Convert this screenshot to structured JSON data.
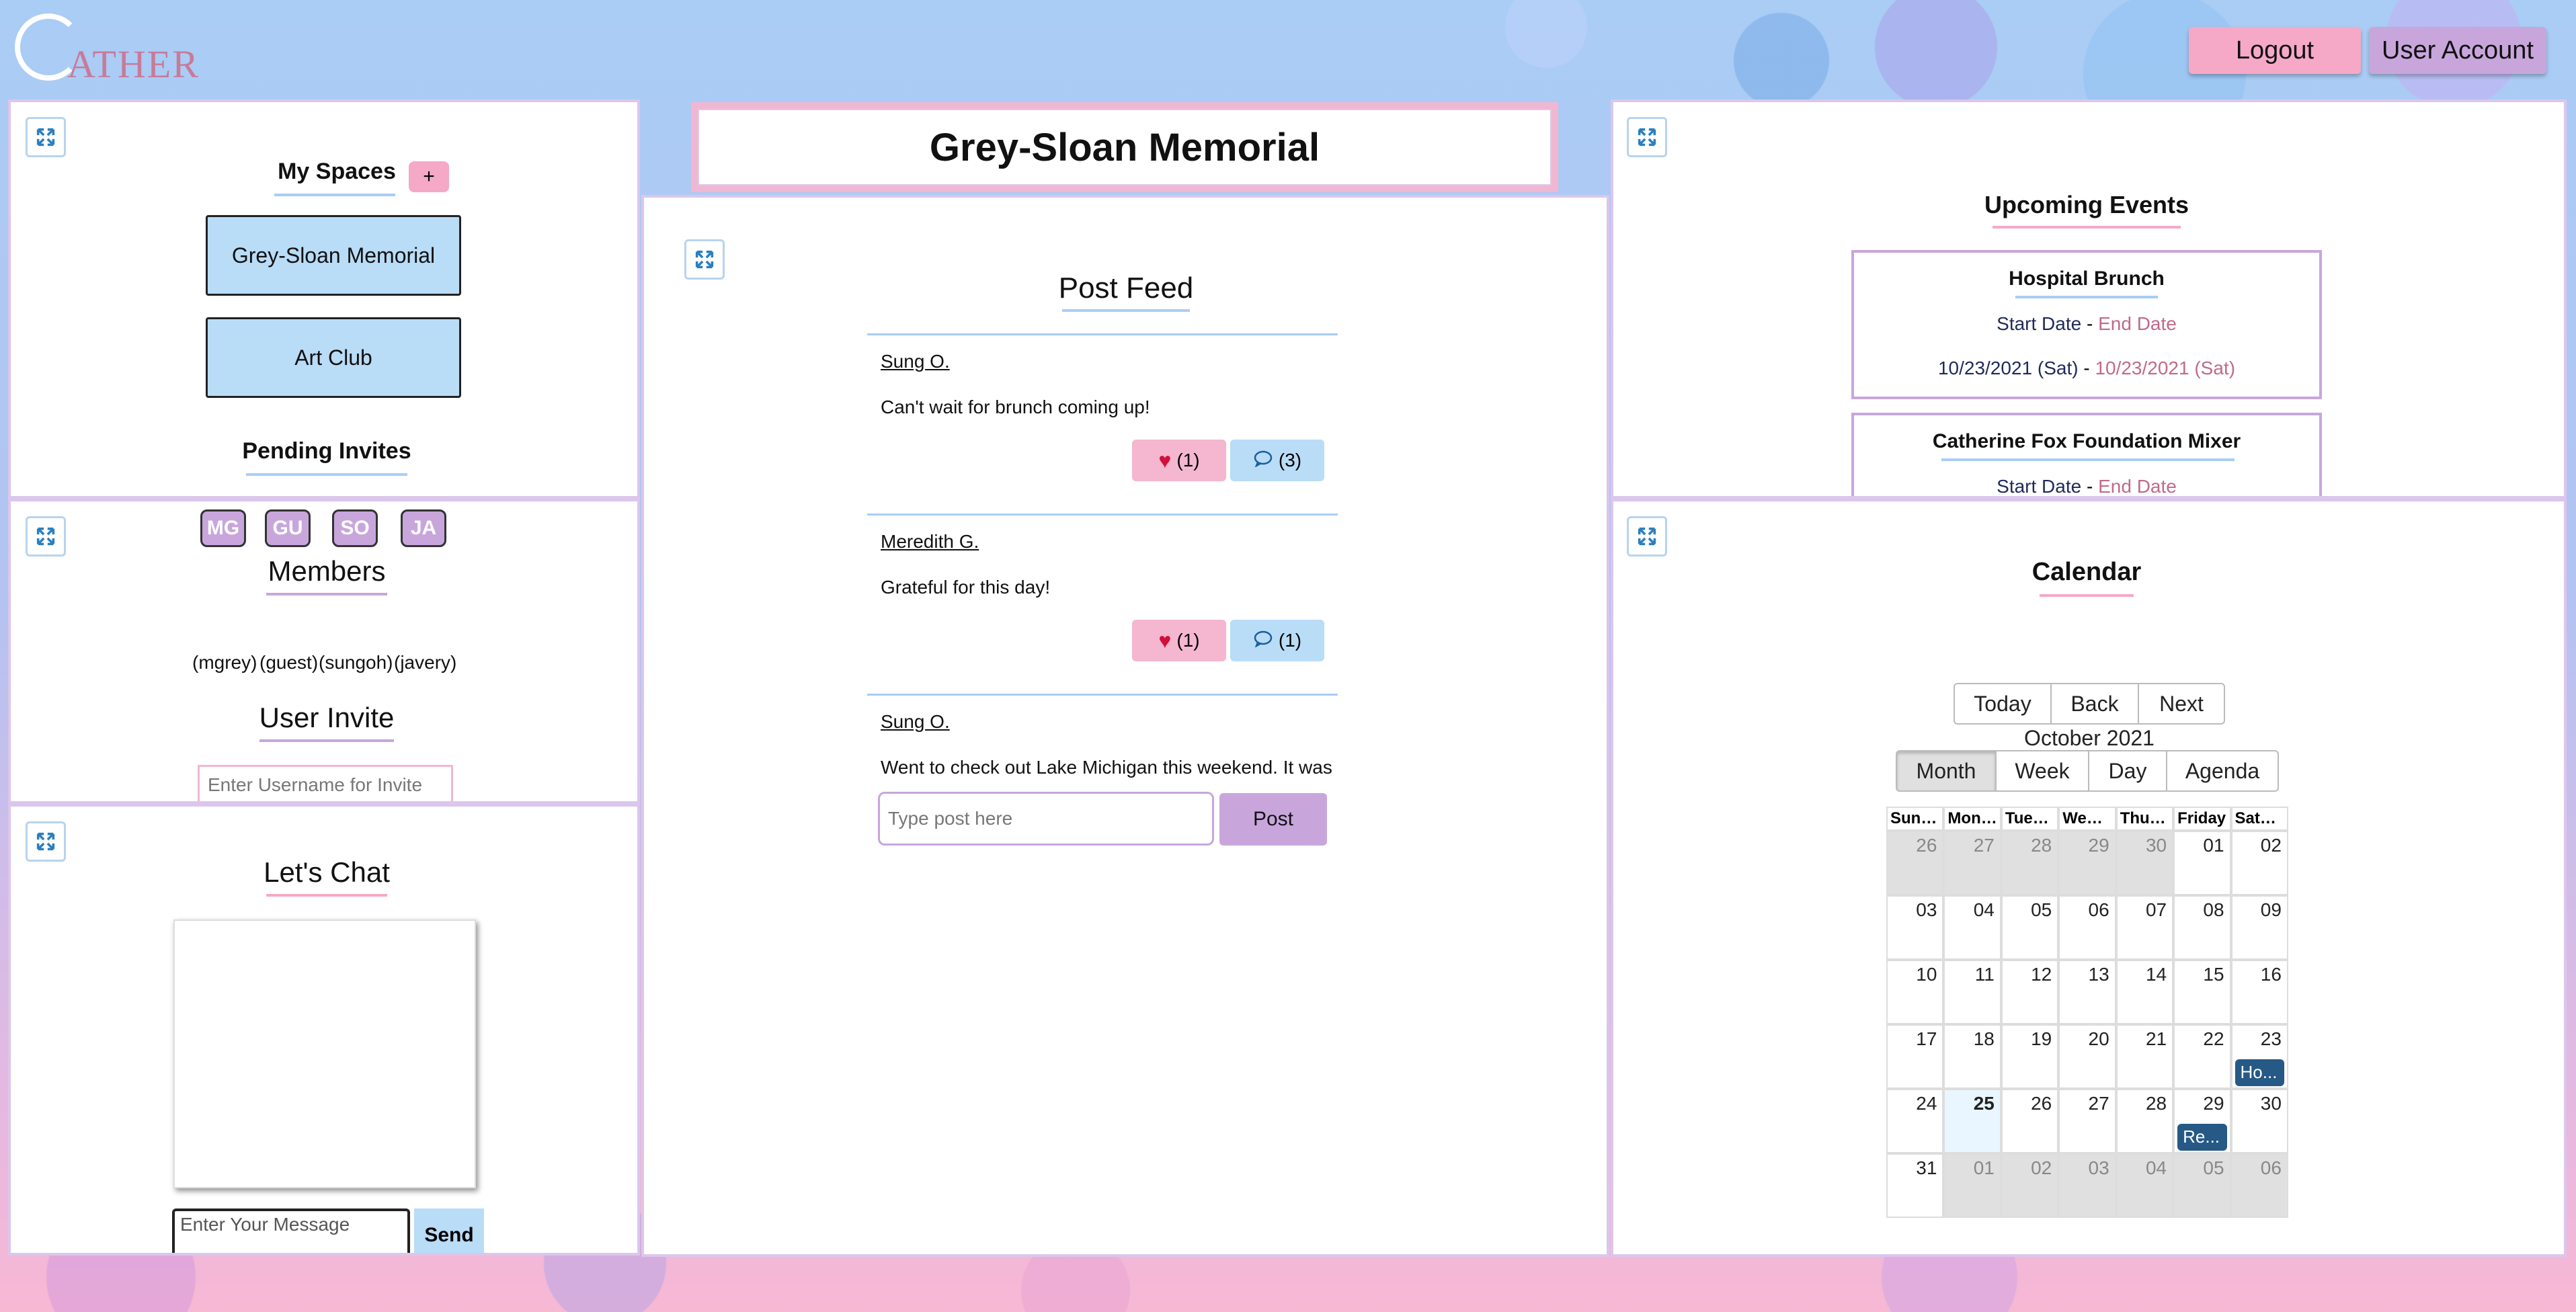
{
  "app": {
    "logo_first": "G",
    "logo_rest": "ATHER"
  },
  "header": {
    "logout_label": "Logout",
    "account_label": "User Account"
  },
  "space_title": "Grey-Sloan Memorial",
  "my_spaces": {
    "title": "My Spaces",
    "add_label": "+",
    "spaces": [
      "Grey-Sloan Memorial",
      "Art Club"
    ],
    "pending_title": "Pending Invites"
  },
  "members": {
    "title": "Members",
    "list": [
      {
        "initials": "MG",
        "username": "(mgrey)"
      },
      {
        "initials": "GU",
        "username": "(guest)"
      },
      {
        "initials": "SO",
        "username": "(sungoh)"
      },
      {
        "initials": "JA",
        "username": "(javery)"
      }
    ],
    "invite_title": "User Invite",
    "invite_placeholder": "Enter Username for Invite"
  },
  "chat": {
    "title": "Let's Chat",
    "message_placeholder": "Enter Your Message",
    "send_label": "Send"
  },
  "feed": {
    "title": "Post Feed",
    "posts": [
      {
        "author": "Sung O.",
        "text": "Can't wait for brunch coming up!",
        "likes": "(1)",
        "comments": "(3)"
      },
      {
        "author": "Meredith G.",
        "text": "Grateful for this day!",
        "likes": "(1)",
        "comments": "(1)"
      },
      {
        "author": "Sung O.",
        "text": "Went to check out Lake Michigan this weekend. It was"
      }
    ],
    "post_placeholder": "Type post here",
    "post_button": "Post"
  },
  "events": {
    "title": "Upcoming Events",
    "start_label": "Start Date",
    "dash": " - ",
    "end_label": "End Date",
    "list": [
      {
        "name": "Hospital Brunch",
        "start": "10/23/2021 (Sat)",
        "end": "10/23/2021 (Sat)"
      },
      {
        "name": "Catherine Fox Foundation Mixer"
      }
    ]
  },
  "calendar": {
    "title": "Calendar",
    "nav": {
      "today": "Today",
      "back": "Back",
      "next": "Next"
    },
    "month_label": "October 2021",
    "views": {
      "month": "Month",
      "week": "Week",
      "day": "Day",
      "agenda": "Agenda"
    },
    "active_view": "Month",
    "weekdays": [
      "Sunday",
      "Monday",
      "Tuesday",
      "Wednesday",
      "Thursday",
      "Friday",
      "Saturday"
    ],
    "weeks": [
      [
        {
          "d": "26",
          "off": true
        },
        {
          "d": "27",
          "off": true
        },
        {
          "d": "28",
          "off": true
        },
        {
          "d": "29",
          "off": true
        },
        {
          "d": "30",
          "off": true
        },
        {
          "d": "01"
        },
        {
          "d": "02"
        }
      ],
      [
        {
          "d": "03"
        },
        {
          "d": "04"
        },
        {
          "d": "05"
        },
        {
          "d": "06"
        },
        {
          "d": "07"
        },
        {
          "d": "08"
        },
        {
          "d": "09"
        }
      ],
      [
        {
          "d": "10"
        },
        {
          "d": "11"
        },
        {
          "d": "12"
        },
        {
          "d": "13"
        },
        {
          "d": "14"
        },
        {
          "d": "15"
        },
        {
          "d": "16"
        }
      ],
      [
        {
          "d": "17"
        },
        {
          "d": "18"
        },
        {
          "d": "19"
        },
        {
          "d": "20"
        },
        {
          "d": "21"
        },
        {
          "d": "22"
        },
        {
          "d": "23",
          "event": "Ho..."
        }
      ],
      [
        {
          "d": "24"
        },
        {
          "d": "25",
          "today": true
        },
        {
          "d": "26"
        },
        {
          "d": "27"
        },
        {
          "d": "28"
        },
        {
          "d": "29",
          "event": "Re..."
        },
        {
          "d": "30"
        }
      ],
      [
        {
          "d": "31"
        },
        {
          "d": "01",
          "off": true
        },
        {
          "d": "02",
          "off": true
        },
        {
          "d": "03",
          "off": true
        },
        {
          "d": "04",
          "off": true
        },
        {
          "d": "05",
          "off": true
        },
        {
          "d": "06",
          "off": true
        }
      ]
    ]
  },
  "colors": {
    "pink": "#f5a9c6",
    "purple": "#c8a6dc",
    "blue": "#b9dcf7",
    "event_blue": "#265985"
  }
}
